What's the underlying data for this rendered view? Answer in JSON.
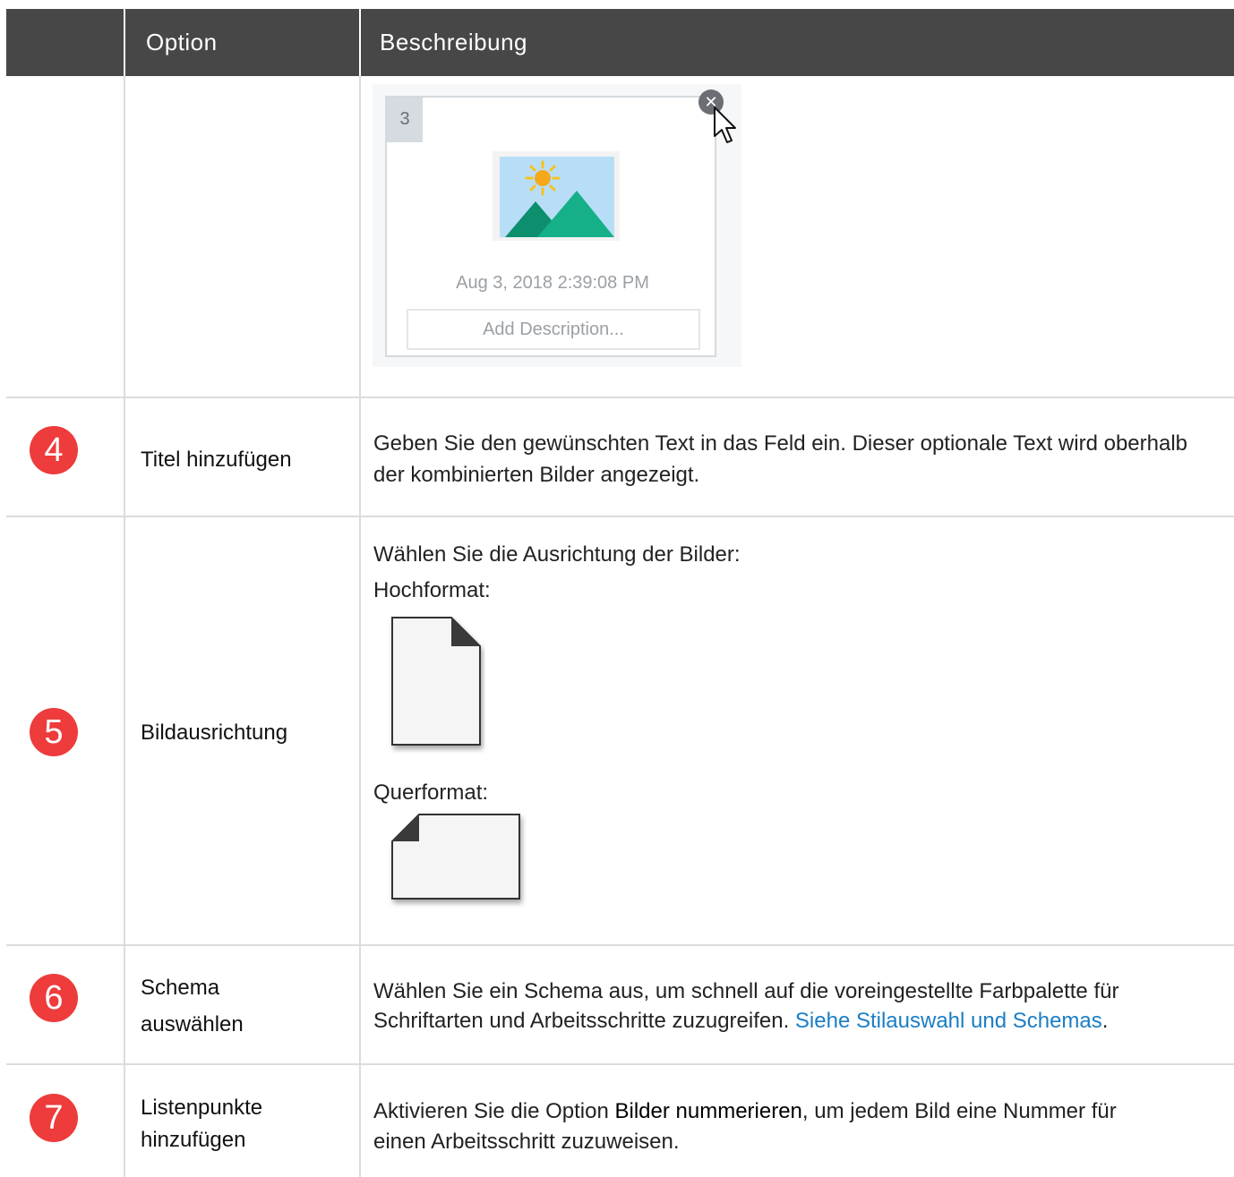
{
  "header": {
    "col_option": "Option",
    "col_description": "Beschreibung"
  },
  "card": {
    "step_number": "3",
    "timestamp": "Aug 3, 2018 2:39:08 PM",
    "description_placeholder": "Add Description...",
    "close_icon": "close-icon"
  },
  "rows": [
    {
      "badge": "4",
      "option": "Titel hinzufügen",
      "description": "Geben Sie den gewünschten Text in das Feld ein. Dieser optionale Text wird oberhalb der kombinierten Bilder angezeigt."
    },
    {
      "badge": "5",
      "option": "Bildausrichtung",
      "intro": "Wählen Sie die Ausrichtung der Bilder:",
      "portrait_label": "Hochformat:",
      "landscape_label": "Querformat:"
    },
    {
      "badge": "6",
      "option_line1": "Schema",
      "option_line2": "auswählen",
      "description_line1": "Wählen Sie ein Schema aus, um schnell auf die voreingestellte Farbpalette für",
      "description_line2": "Schriftarten und Arbeitsschritte zuzugreifen. ",
      "link": "Siehe Stilauswahl und Schemas",
      "after_link": "."
    },
    {
      "badge": "7",
      "option_line1": "Listenpunkte",
      "option_line2": "hinzufügen",
      "desc_before": "Aktivieren Sie die Option ",
      "desc_bold": "Bilder nummerieren",
      "desc_after": ", um jedem Bild eine Nummer für",
      "desc_line2": "einen Arbeitsschritt zuzuweisen."
    }
  ],
  "colors": {
    "header_bg": "#474747",
    "badge": "#ee3b3b",
    "link": "#1a7ec5",
    "border": "#dcdcdc"
  }
}
